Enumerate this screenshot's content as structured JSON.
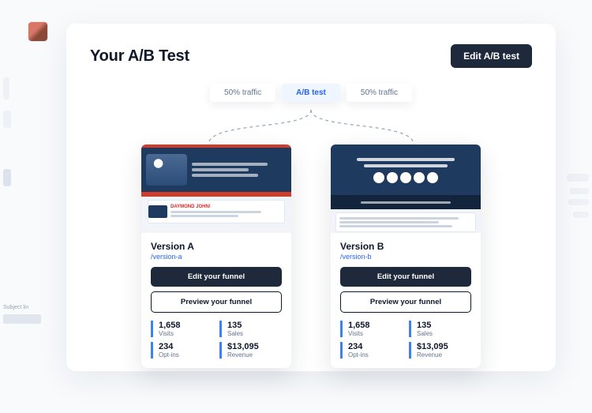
{
  "page": {
    "title": "Your A/B Test",
    "edit_label": "Edit A/B test"
  },
  "pills": {
    "left": "50% traffic",
    "center": "A/B test",
    "right": "50% traffic"
  },
  "buttons": {
    "edit_funnel": "Edit your funnel",
    "preview_funnel": "Preview your funnel"
  },
  "stat_labels": {
    "visits": "Visits",
    "sales": "Sales",
    "optins": "Opt-ins",
    "revenue": "Revenue"
  },
  "ghost": {
    "subject_label": "Subject lin"
  },
  "versions": [
    {
      "name": "Version A",
      "slug": "/version-a",
      "thumb_red_text": "DAYMOND JOHN!",
      "stats": {
        "visits": "1,658",
        "sales": "135",
        "optins": "234",
        "revenue": "$13,095"
      }
    },
    {
      "name": "Version B",
      "slug": "/version-b",
      "stats": {
        "visits": "1,658",
        "sales": "135",
        "optins": "234",
        "revenue": "$13,095"
      }
    }
  ]
}
